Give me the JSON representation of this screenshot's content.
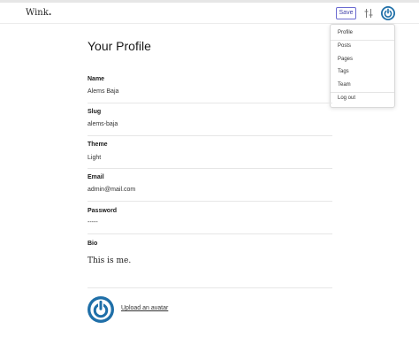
{
  "header": {
    "logo_main": "Wink",
    "logo_dot": ".",
    "save_label": "Save",
    "settings_icon": "sliders-icon",
    "avatar_icon": "power-icon",
    "brand_color": "#1f6fa8"
  },
  "menu": {
    "items": [
      {
        "label": "Profile"
      },
      {
        "label": "Posts"
      },
      {
        "label": "Pages"
      },
      {
        "label": "Tags"
      },
      {
        "label": "Team"
      },
      {
        "label": "Log out"
      }
    ]
  },
  "profile": {
    "title": "Your Profile",
    "name_label": "Name",
    "name_value": "Alems Baja",
    "slug_label": "Slug",
    "slug_value": "alems-baja",
    "theme_label": "Theme",
    "theme_value": "Light",
    "email_label": "Email",
    "email_value": "admin@mail.com",
    "password_label": "Password",
    "password_value": "-----",
    "bio_label": "Bio",
    "bio_value": "This is me.",
    "upload_label": "Upload an avatar"
  }
}
